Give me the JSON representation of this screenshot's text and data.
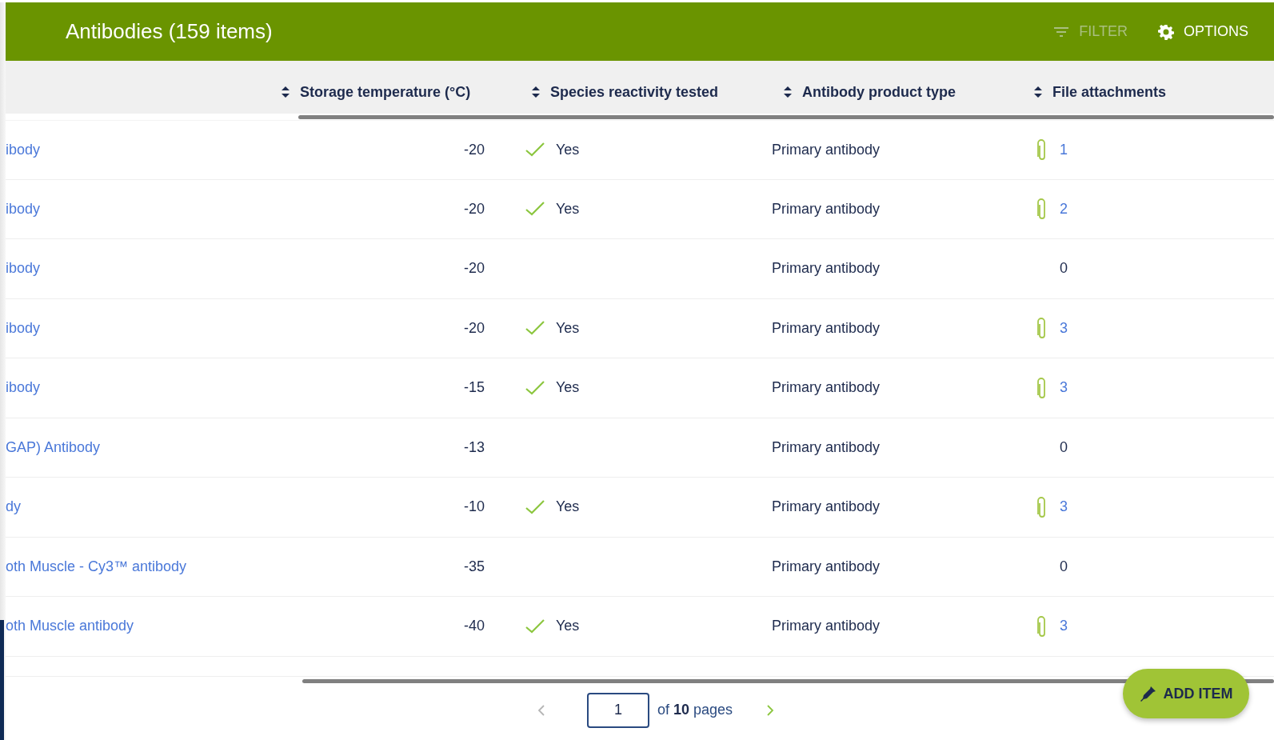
{
  "header": {
    "title": "Antibodies (159 items)",
    "actions": [
      {
        "kind": "filter",
        "label": "FILTER",
        "disabled": true
      },
      {
        "kind": "options",
        "label": "OPTIONS",
        "disabled": false
      }
    ]
  },
  "table": {
    "columns": [
      "Storage temperature (°C)",
      "Species reactivity tested",
      "Antibody product type",
      "File attachments"
    ],
    "rows": [
      {
        "name": "ibody",
        "temperature": "-20",
        "tested": true,
        "tested_label": "Yes",
        "type": "Primary antibody",
        "has_files": true,
        "files": "1"
      },
      {
        "name": "ibody",
        "temperature": "-20",
        "tested": true,
        "tested_label": "Yes",
        "type": "Primary antibody",
        "has_files": true,
        "files": "2"
      },
      {
        "name": "ibody",
        "temperature": "-20",
        "tested": false,
        "type": "Primary antibody",
        "has_files": false,
        "files": "0"
      },
      {
        "name": "ibody",
        "temperature": "-20",
        "tested": true,
        "tested_label": "Yes",
        "type": "Primary antibody",
        "has_files": true,
        "files": "3"
      },
      {
        "name": "ibody",
        "temperature": "-15",
        "tested": true,
        "tested_label": "Yes",
        "type": "Primary antibody",
        "has_files": true,
        "files": "3"
      },
      {
        "name": "GAP) Antibody",
        "temperature": "-13",
        "tested": false,
        "type": "Primary antibody",
        "has_files": false,
        "files": "0"
      },
      {
        "name": "dy",
        "temperature": "-10",
        "tested": true,
        "tested_label": "Yes",
        "type": "Primary antibody",
        "has_files": true,
        "files": "3"
      },
      {
        "name": "oth Muscle - Cy3™ antibody",
        "temperature": "-35",
        "tested": false,
        "type": "Primary antibody",
        "has_files": false,
        "files": "0"
      },
      {
        "name": "oth Muscle antibody",
        "temperature": "-40",
        "tested": true,
        "tested_label": "Yes",
        "type": "Primary antibody",
        "has_files": true,
        "files": "3"
      }
    ]
  },
  "pagination": {
    "previous_disabled": true,
    "page": "1",
    "summary": "of **10** pages",
    "next_disabled": false
  },
  "add_button": {
    "label": "ADD ITEM"
  }
}
